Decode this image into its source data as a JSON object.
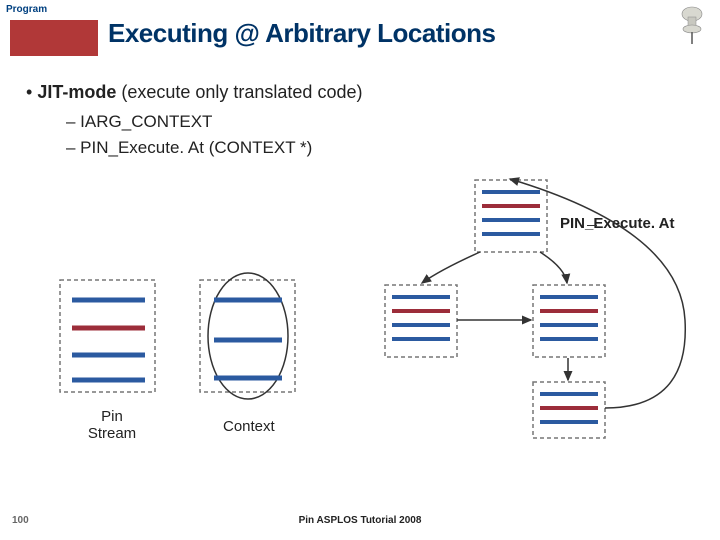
{
  "topLeftLabel": "Program",
  "title": "Executing @ Arbitrary Locations",
  "bullet": {
    "bold": "JIT-mode",
    "rest": " (execute only translated code)"
  },
  "sub1": "–  IARG_CONTEXT",
  "sub2": "–  PIN_Execute. At (CONTEXT *)",
  "execLabel": "PIN_Execute. At",
  "pinStream": "Pin Stream",
  "contextLabel": "Context",
  "pageNum": "100",
  "footer": "Pin ASPLOS Tutorial 2008"
}
